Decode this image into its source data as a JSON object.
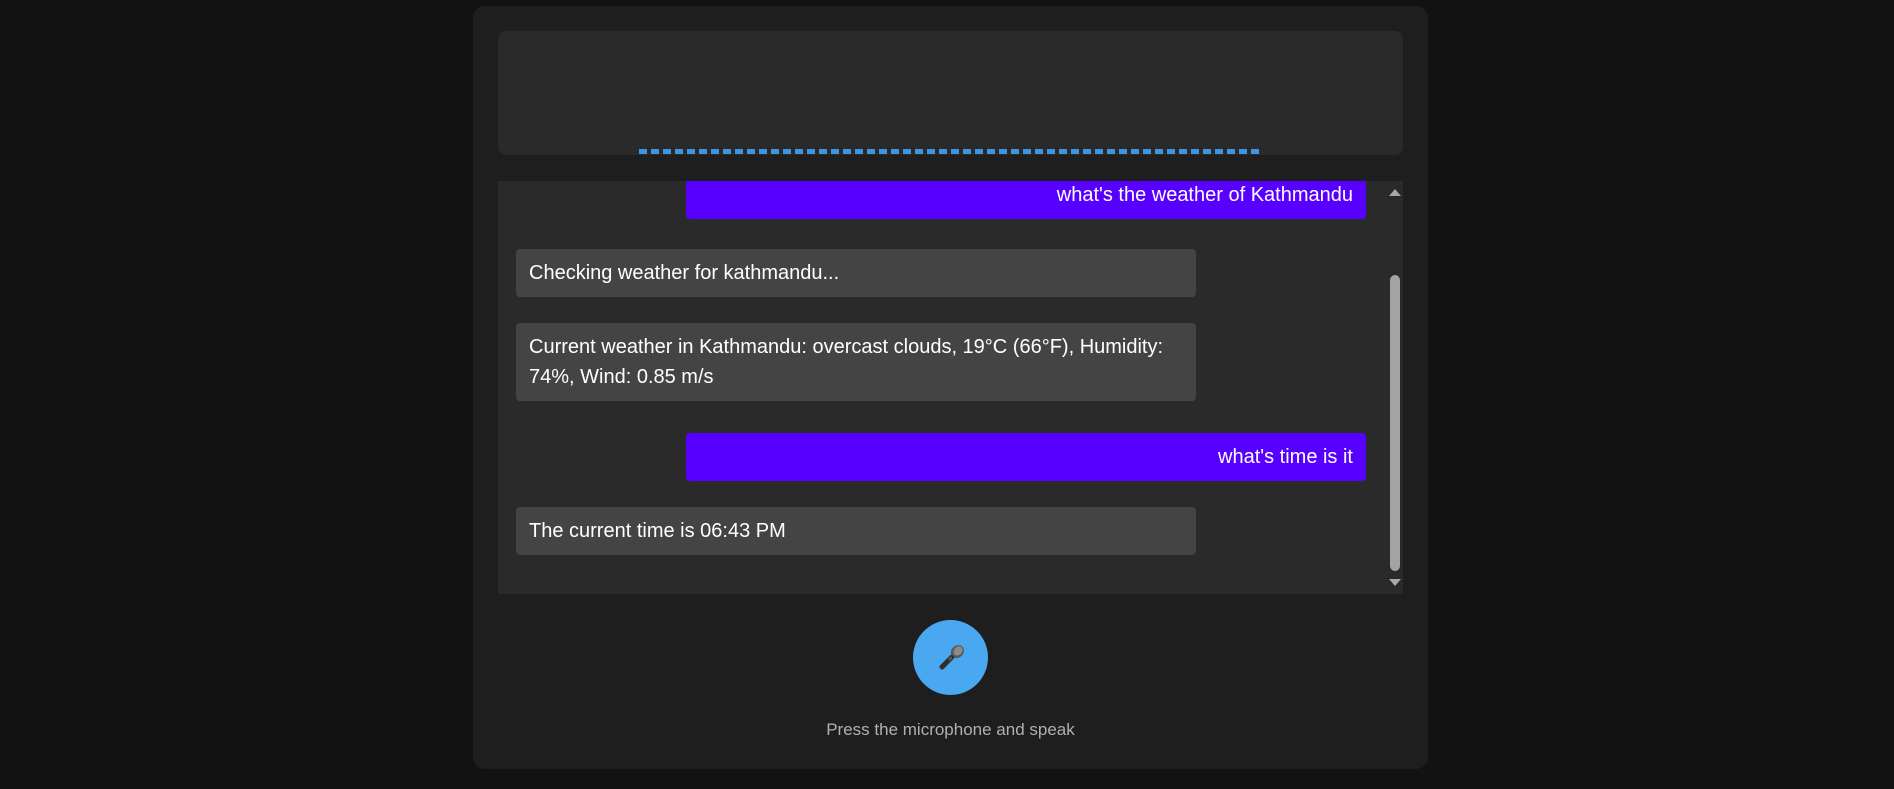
{
  "messages": [
    {
      "role": "user",
      "text": "what's the weather of Kathmandu"
    },
    {
      "role": "bot",
      "text": "Checking weather for kathmandu..."
    },
    {
      "role": "bot",
      "text": "Current weather in Kathmandu: overcast clouds, 19°C (66°F), Humidity: 74%, Wind: 0.85 m/s"
    },
    {
      "role": "user",
      "text": "what's time is it"
    },
    {
      "role": "bot",
      "text": "The current time is 06:43 PM"
    }
  ],
  "mic": {
    "icon": "microphone-icon"
  },
  "hint": "Press the microphone and speak",
  "colors": {
    "background": "#121212",
    "panel": "#1e1e1e",
    "user_bubble": "#5800ff",
    "bot_bubble": "#444444",
    "accent": "#4aa8f0",
    "visualizer_bar": "#3e95e4"
  }
}
